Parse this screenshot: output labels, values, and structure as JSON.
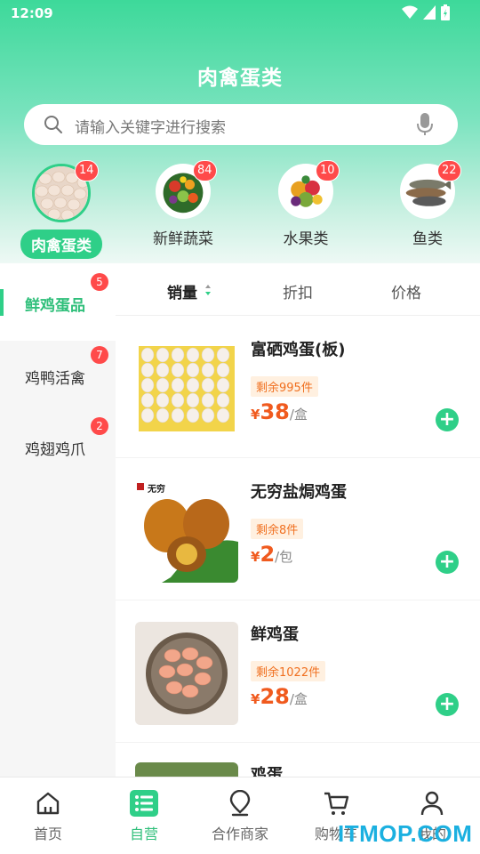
{
  "status_bar": {
    "time": "12:09"
  },
  "header": {
    "title": "肉禽蛋类"
  },
  "search": {
    "placeholder": "请输入关键字进行搜索"
  },
  "categories": [
    {
      "label": "肉禽蛋类",
      "badge": "14",
      "active": true
    },
    {
      "label": "新鲜蔬菜",
      "badge": "84",
      "active": false
    },
    {
      "label": "水果类",
      "badge": "10",
      "active": false
    },
    {
      "label": "鱼类",
      "badge": "22",
      "active": false
    }
  ],
  "sidebar": {
    "items": [
      {
        "label": "鲜鸡蛋品",
        "badge": "5",
        "active": true
      },
      {
        "label": "鸡鸭活禽",
        "badge": "7",
        "active": false
      },
      {
        "label": "鸡翅鸡爪",
        "badge": "2",
        "active": false
      }
    ]
  },
  "sort": {
    "tabs": [
      "销量",
      "折扣",
      "价格"
    ]
  },
  "products": [
    {
      "name": "富硒鸡蛋(板)",
      "stock": "剩余995件",
      "currency": "¥",
      "price": "38",
      "unit": "/盒"
    },
    {
      "name": "无穷盐焗鸡蛋",
      "stock": "剩余8件",
      "currency": "¥",
      "price": "2",
      "unit": "/包",
      "brand_text": "无穷"
    },
    {
      "name": "鲜鸡蛋",
      "stock": "剩余1022件",
      "currency": "¥",
      "price": "28",
      "unit": "/盒"
    },
    {
      "name": "鸡蛋"
    }
  ],
  "bottom_nav": [
    {
      "label": "首页",
      "icon": "home-icon"
    },
    {
      "label": "自营",
      "icon": "list-icon",
      "active": true
    },
    {
      "label": "合作商家",
      "icon": "location-icon"
    },
    {
      "label": "购物车",
      "icon": "cart-icon"
    },
    {
      "label": "我的",
      "icon": "user-icon"
    }
  ],
  "watermark": "ITMOP.COM",
  "colors": {
    "accent": "#2fcf88",
    "price": "#f05a1e",
    "badge": "#ff4a4a"
  }
}
